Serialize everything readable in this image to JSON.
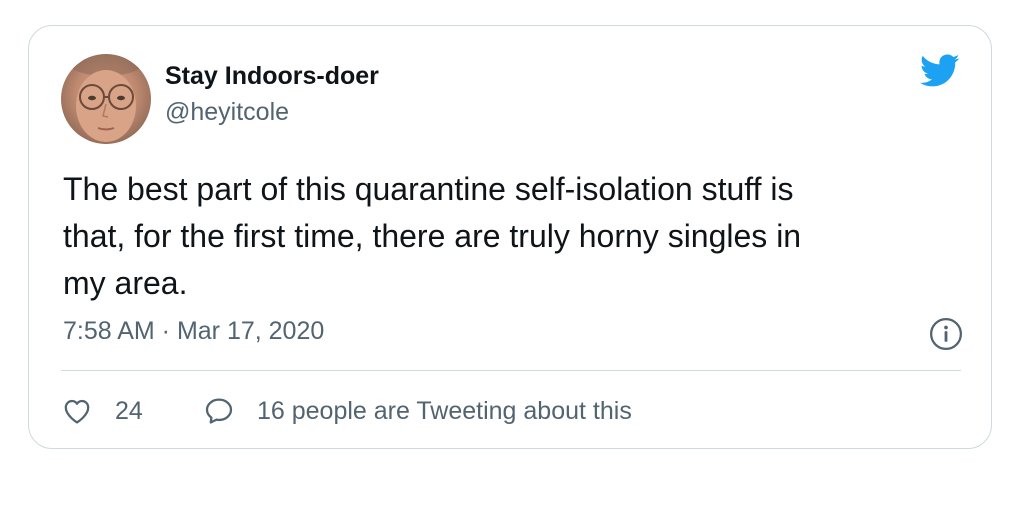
{
  "tweet": {
    "author_name": "Stay Indoors-doer",
    "author_handle": "@heyitcole",
    "text_lines": [
      "The best part of this quarantine self-isolation stuff is",
      "that, for the first time, there are truly horny singles in",
      "my area."
    ],
    "timestamp": "7:58 AM · Mar 17, 2020",
    "like_count": "24",
    "conversation_label": "16 people are Tweeting about this"
  },
  "icons": {
    "brand": "twitter-bird-icon",
    "info": "info-icon",
    "like": "heart-icon",
    "reply": "speech-bubble-icon"
  },
  "colors": {
    "brand": "#1da1f2",
    "text": "#0f1419",
    "secondary_text": "#536471",
    "border": "#cfd9de"
  }
}
